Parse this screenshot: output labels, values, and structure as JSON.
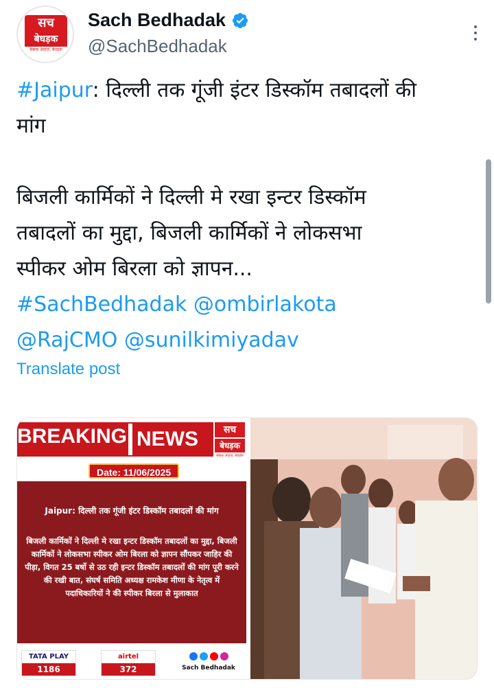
{
  "post": {
    "display_name": "Sach Bedhadak",
    "handle": "@SachBedhadak",
    "avatar": {
      "line1": "सच",
      "line2": "बेधड़क",
      "tagline": "बेबाक अंदाज़, बेधड़क"
    },
    "line1_hashtag": "#Jaipur",
    "line1_rest": ": दिल्ली तक गूंजी इंटर डिस्कॉम तबादलों की",
    "line2": "मांग",
    "body_line1": "बिजली कार्मिकों ने दिल्ली मे रखा इन्टर डिस्कॉम",
    "body_line2": "तबादलों का मुद्दा, बिजली कार्मिकों ने लोकसभा",
    "body_line3": "स्पीकर ओम बिरला को ज्ञापन...",
    "tags_line1": "#SachBedhadak @ombirlakota",
    "tags_line2": "@RajCMO @sunilkimiyadav",
    "translate_label": "Translate post"
  },
  "media_card": {
    "breaking": "BREAKING",
    "news": "NEWS",
    "logo_line1": "सच",
    "logo_line2": "बेधड़क",
    "logo_tagline": "बेबाक अंदाज़, बेधड़क",
    "date": "Date: 11/06/2025",
    "title": "Jaipur: दिल्ली तक गूंजी इंटर डिस्कॉम तबादलों की मांग",
    "paragraph": "बिजली कार्मिकों ने दिल्ली मे रखा इन्टर डिस्कॉम तबादलों का मुद्दा, बिजली कार्मिकों ने लोकसभा स्पीकर ओम बिरला को ज्ञापन सौंपकर जाहिर की पीड़ा, विगत 25 बर्षो से उठ रही इन्टर डिस्कॉम तबादलों की मांग पूरी करने की रखी बात, संघर्ष समिति अध्यक्ष रामकेश मीणा के नेतृत्व में पदाधिकारियों ने की स्पीकर बिरला से मुलाकात",
    "tataplay_label": "TATA PLAY",
    "tataplay_channel": "1186",
    "airtel_label": "airtel",
    "airtel_channel": "372",
    "social_name": "Sach Bedhadak"
  },
  "colors": {
    "link": "#1d9bf0",
    "brand_red": "#c8161d",
    "card_maroon": "#8b1a1f"
  },
  "icons": [
    "verified-badge-icon",
    "more-options-icon",
    "facebook-icon",
    "twitter-icon",
    "youtube-icon",
    "instagram-icon"
  ]
}
